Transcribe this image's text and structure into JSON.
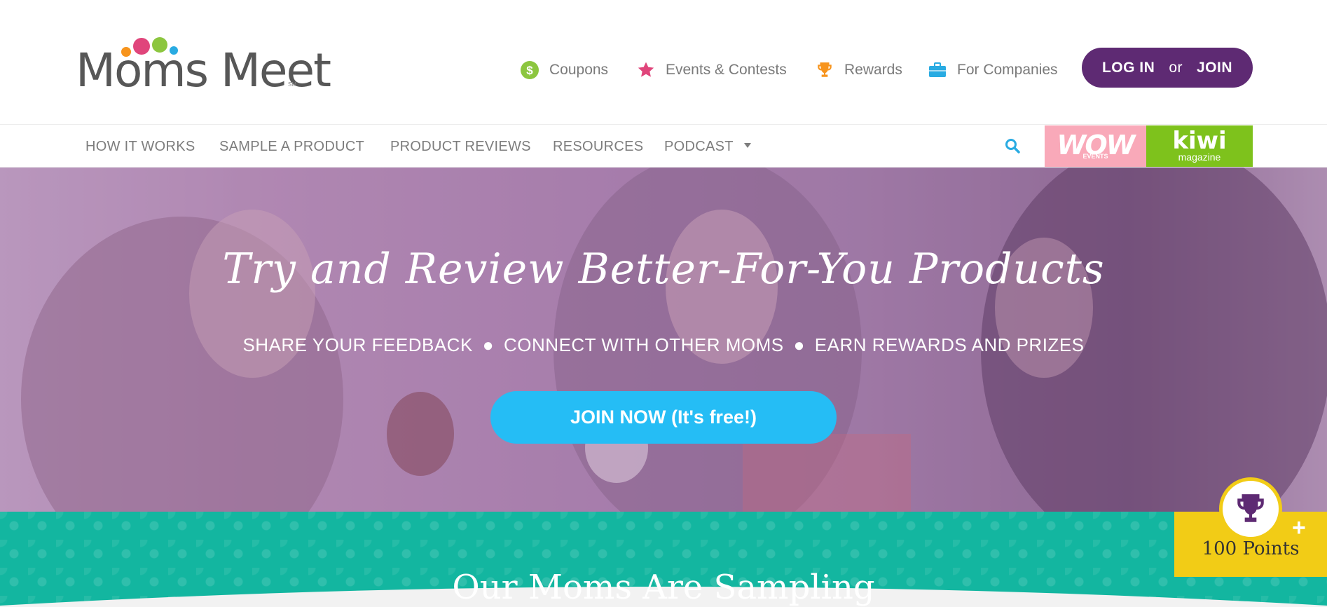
{
  "header": {
    "logo_text": "Moms Meet",
    "logo_mark": "SM",
    "util_nav": [
      {
        "label": "Coupons",
        "icon": "dollar-icon",
        "color": "#8cc63f"
      },
      {
        "label": "Events & Contests",
        "icon": "star-icon",
        "color": "#e0457b"
      },
      {
        "label": "Rewards",
        "icon": "trophy-icon",
        "color": "#f7941d"
      },
      {
        "label": "For Companies",
        "icon": "briefcase-icon",
        "color": "#29abe2"
      }
    ],
    "auth": {
      "login": "LOG IN",
      "or": "or",
      "join": "JOIN",
      "bg_color": "#5e2a73"
    }
  },
  "main_nav": {
    "items": [
      {
        "label": "HOW IT WORKS"
      },
      {
        "label": "SAMPLE A PRODUCT"
      },
      {
        "label": "PRODUCT REVIEWS"
      },
      {
        "label": "RESOURCES"
      },
      {
        "label": "PODCAST"
      }
    ],
    "wow": {
      "label": "WOW",
      "sub": "EVENTS"
    },
    "kiwi": {
      "label": "kiwi",
      "sub": "magazine"
    }
  },
  "hero": {
    "title": "Try and Review Better-For-You Products",
    "subtitle_parts": [
      "SHARE YOUR FEEDBACK",
      "CONNECT WITH OTHER MOMS",
      "EARN REWARDS AND PRIZES"
    ],
    "separator": "●",
    "cta": "JOIN NOW (It's free!)",
    "cta_color": "#25bdf5"
  },
  "section": {
    "title": "Our Moms Are Sampling",
    "bg_color": "#13b6a0"
  },
  "points_widget": {
    "label": "100 Points",
    "plus": "+",
    "bg_color": "#f2cc16"
  }
}
